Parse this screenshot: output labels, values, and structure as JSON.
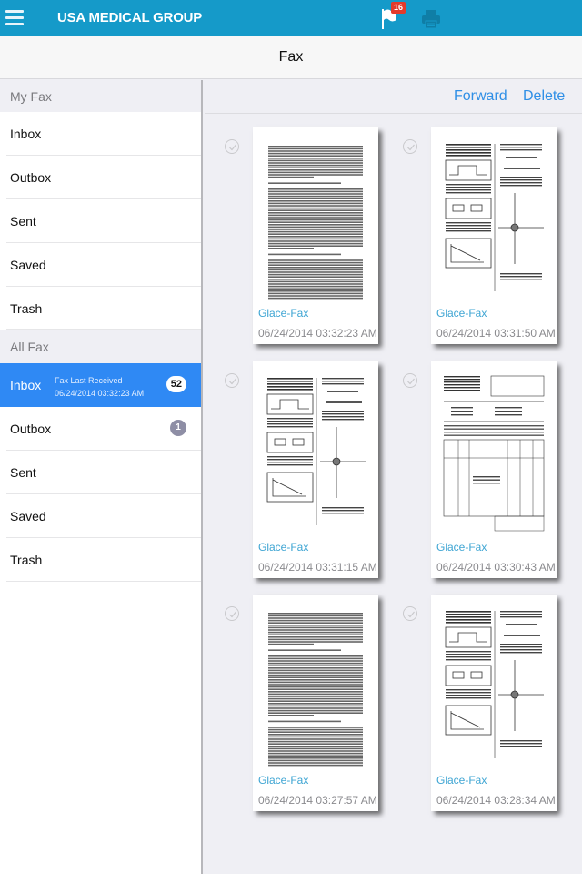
{
  "header": {
    "app_title": "USA MEDICAL GROUP",
    "menu_icon": "hamburger-menu-icon",
    "flag_icon": "flag-icon",
    "flag_badge": "16",
    "print_icon": "printer-icon",
    "accent_color": "#159ac9"
  },
  "navbar": {
    "title": "Fax"
  },
  "sidebar": {
    "sections": [
      {
        "label": "My Fax",
        "items": [
          {
            "label": "Inbox"
          },
          {
            "label": "Outbox"
          },
          {
            "label": "Sent"
          },
          {
            "label": "Saved"
          },
          {
            "label": "Trash"
          }
        ]
      },
      {
        "label": "All Fax",
        "items": [
          {
            "label": "Inbox",
            "selected": true,
            "sub_title": "Fax Last Received",
            "sub_date": "06/24/2014 03:32:23 AM",
            "badge": "52"
          },
          {
            "label": "Outbox",
            "badge": "1"
          },
          {
            "label": "Sent"
          },
          {
            "label": "Saved"
          },
          {
            "label": "Trash"
          }
        ]
      }
    ]
  },
  "actions": {
    "forward": "Forward",
    "delete": "Delete"
  },
  "faxes": [
    {
      "name": "Glace-Fax",
      "date": "06/24/2014 03:32:23 AM",
      "thumb": "text-document"
    },
    {
      "name": "Glace-Fax",
      "date": "06/24/2014 03:31:50 AM",
      "thumb": "diagram-document"
    },
    {
      "name": "Glace-Fax",
      "date": "06/24/2014 03:31:15 AM",
      "thumb": "diagram-document"
    },
    {
      "name": "Glace-Fax",
      "date": "06/24/2014 03:30:43 AM",
      "thumb": "form-document"
    },
    {
      "name": "Glace-Fax",
      "date": "06/24/2014 03:27:57 AM",
      "thumb": "text-document"
    },
    {
      "name": "Glace-Fax",
      "date": "06/24/2014 03:28:34 AM",
      "thumb": "diagram-document"
    }
  ]
}
